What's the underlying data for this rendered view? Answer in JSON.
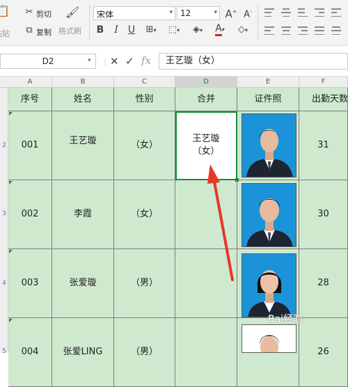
{
  "ribbon": {
    "paste_label": "粘贴",
    "cut_label": "剪切",
    "copy_label": "复制",
    "format_painter_label": "格式刷",
    "font_name": "宋体",
    "font_size": "12",
    "bold_glyph": "B",
    "italic_glyph": "I",
    "underline_glyph": "U",
    "grow_font_glyph": "A",
    "shrink_font_glyph": "A",
    "font_color_glyph": "A"
  },
  "formula_bar": {
    "name_box": "D2",
    "cancel_glyph": "✕",
    "enter_glyph": "✓",
    "fx_label": "fx",
    "content": "王艺璇（女）"
  },
  "grid": {
    "columns": [
      "A",
      "B",
      "C",
      "D",
      "E",
      "F"
    ],
    "rows": [
      "2",
      "3",
      "4",
      "5"
    ],
    "headers": [
      "序号",
      "姓名",
      "性别",
      "合并",
      "证件照",
      "出勤天数"
    ],
    "records": [
      {
        "num": "001",
        "name": "王艺璇",
        "gender": "（女）",
        "merged_line1": "王艺璇",
        "merged_line2": "（女）",
        "days": "31"
      },
      {
        "num": "002",
        "name": "李霞",
        "gender": "（女）",
        "merged_line1": "",
        "merged_line2": "",
        "days": "30"
      },
      {
        "num": "003",
        "name": "张爱璇",
        "gender": "（男）",
        "merged_line1": "",
        "merged_line2": "",
        "days": "28"
      },
      {
        "num": "004",
        "name": "张爱LING",
        "gender": "（男）",
        "merged_line1": "",
        "merged_line2": "",
        "days": "26"
      }
    ]
  },
  "watermark": "Bai经验",
  "colors": {
    "cell_fill": "#cfe9cf",
    "selection": "#1e8a3c",
    "photo_background": "#1b93d8",
    "arrow": "#e8362a"
  }
}
